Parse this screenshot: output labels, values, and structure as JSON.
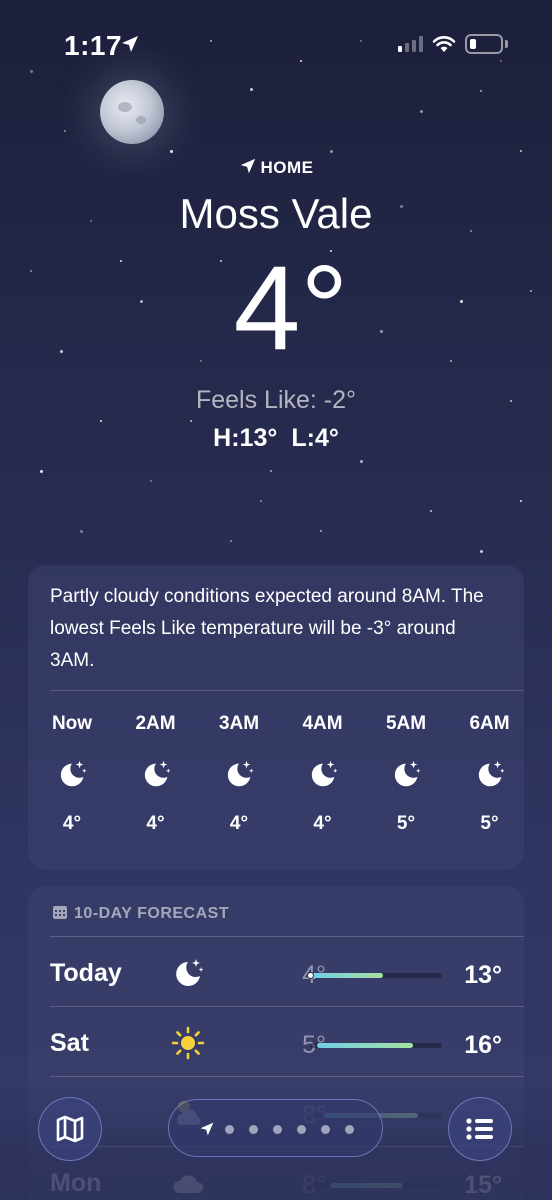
{
  "status_bar": {
    "time": "1:17",
    "signal_bars": 4,
    "signal_active": 1,
    "battery_level": 0.15
  },
  "header": {
    "home_label": "HOME",
    "city": "Moss Vale",
    "temperature": "4°",
    "feels_like": "Feels Like: -2°",
    "high": "H:13°",
    "low": "L:4°"
  },
  "hourly": {
    "summary": "Partly cloudy conditions expected around 8AM. The lowest Feels Like temperature will be -3° around 3AM.",
    "hours": [
      {
        "label": "Now",
        "icon": "moon-stars-icon",
        "temp": "4°"
      },
      {
        "label": "2AM",
        "icon": "moon-stars-icon",
        "temp": "4°"
      },
      {
        "label": "3AM",
        "icon": "moon-stars-icon",
        "temp": "4°"
      },
      {
        "label": "4AM",
        "icon": "moon-stars-icon",
        "temp": "4°"
      },
      {
        "label": "5AM",
        "icon": "moon-stars-icon",
        "temp": "5°"
      },
      {
        "label": "6AM",
        "icon": "moon-stars-icon",
        "temp": "5°"
      }
    ]
  },
  "daily": {
    "header": "10-DAY FORECAST",
    "days": [
      {
        "name": "Today",
        "icon": "moon-stars-icon",
        "low": "4°",
        "high": "13°",
        "range_start": 0.0,
        "range_end": 0.55,
        "current": 0.0
      },
      {
        "name": "Sat",
        "icon": "sun-icon",
        "low": "5°",
        "high": "16°",
        "range_start": 0.05,
        "range_end": 0.78
      },
      {
        "name": "",
        "icon": "sun-cloud-icon",
        "low": "8°",
        "high": "",
        "range_start": 0.1,
        "range_end": 0.82
      },
      {
        "name": "Mon",
        "icon": "cloud-icon",
        "low": "8°",
        "high": "15°",
        "range_start": 0.15,
        "range_end": 0.7
      }
    ]
  },
  "toolbar": {
    "page_count": 6
  },
  "colors": {
    "bar_gradient_start": "#6fd0e8",
    "bar_gradient_end": "#a8e0a0",
    "accent": "#8aa0e6"
  }
}
